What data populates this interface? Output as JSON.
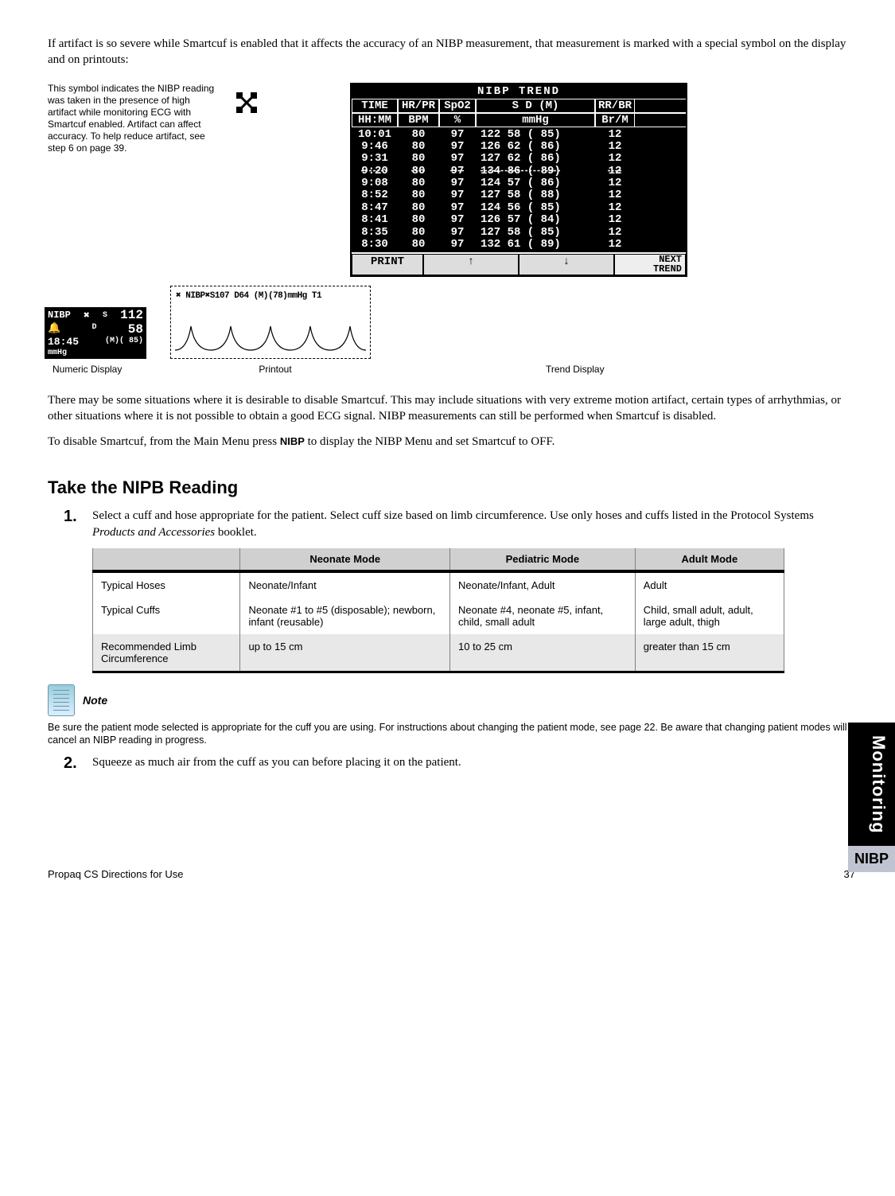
{
  "intro": "If artifact is so severe while Smartcuf is enabled that it affects the accuracy of an NIBP measurement, that measurement is marked with a special symbol on the display and on printouts:",
  "artifact_note": "This symbol indicates the NIBP reading was taken in the presence of high artifact while monitoring ECG with Smartcuf enabled. Artifact can affect accuracy. To help reduce artifact, see step 6 on page 39.",
  "trend": {
    "title": "NIBP TREND",
    "headers": [
      "TIME",
      "HR/PR",
      "SpO2",
      "S  D  (M)",
      "RR/BR"
    ],
    "units": [
      "HH:MM",
      "BPM",
      "%",
      "mmHg",
      "Br/M"
    ],
    "rows": [
      {
        "t": "10:01",
        "hr": "80",
        "sp": "97",
        "sdm": "122 58 ( 85)",
        "rr": "12"
      },
      {
        "t": " 9:46",
        "hr": "80",
        "sp": "97",
        "sdm": "126 62 ( 86)",
        "rr": "12"
      },
      {
        "t": " 9:31",
        "hr": "80",
        "sp": "97",
        "sdm": "127 62 ( 86)",
        "rr": "12"
      },
      {
        "t": " 9:20",
        "hr": "80",
        "sp": "97",
        "sdm": "134 86 ( 89)",
        "rr": "12",
        "strike": true
      },
      {
        "t": " 9:08",
        "hr": "80",
        "sp": "97",
        "sdm": "124 57 ( 86)",
        "rr": "12"
      },
      {
        "t": " 8:52",
        "hr": "80",
        "sp": "97",
        "sdm": "127 58 ( 88)",
        "rr": "12"
      },
      {
        "t": " 8:47",
        "hr": "80",
        "sp": "97",
        "sdm": "124 56 ( 85)",
        "rr": "12"
      },
      {
        "t": " 8:41",
        "hr": "80",
        "sp": "97",
        "sdm": "126 57 ( 84)",
        "rr": "12"
      },
      {
        "t": " 8:35",
        "hr": "80",
        "sp": "97",
        "sdm": "127 58 ( 85)",
        "rr": "12"
      },
      {
        "t": " 8:30",
        "hr": "80",
        "sp": "97",
        "sdm": "132 61 ( 89)",
        "rr": "12"
      }
    ],
    "footer": {
      "print": "PRINT",
      "up": "↑",
      "down": "↓",
      "next": "NEXT\nTREND"
    }
  },
  "numeric": {
    "label": "NIBP",
    "s_lbl": "S",
    "s": "112",
    "d_lbl": "D",
    "d": "58",
    "time": "18:45",
    "m": "(M)( 85)",
    "unit": "mmHg"
  },
  "printout_text": "✖ NIBP✖S107 D64 (M)(78)mmHg T1",
  "captions": {
    "num": "Numeric Display",
    "pr": "Printout",
    "tr": "Trend Display"
  },
  "para1": "There may be some situations where it is desirable to disable Smartcuf. This may include situations with very extreme motion artifact, certain types of arrhythmias, or other situations where it is not possible to obtain a good ECG signal. NIBP measurements can still be performed when Smartcuf is disabled.",
  "para2a": "To disable Smartcuf, from the Main Menu press ",
  "para2_key": "NIBP",
  "para2b": " to display the NIBP Menu and set Smartcuf to OFF.",
  "section_title": "Take the NIPB Reading",
  "step1_num": "1.",
  "step1_a": "Select a cuff and hose appropriate for the patient. Select cuff size based on limb circumference. Use only hoses and cuffs listed in the Protocol Systems ",
  "step1_i": "Products and Accessories",
  "step1_b": " booklet.",
  "table": {
    "cols": [
      "",
      "Neonate Mode",
      "Pediatric Mode",
      "Adult Mode"
    ],
    "rows": [
      [
        "Typical Hoses",
        "Neonate/Infant",
        "Neonate/Infant, Adult",
        "Adult"
      ],
      [
        "Typical Cuffs",
        "Neonate #1 to #5 (disposable); newborn, infant (reusable)",
        "Neonate #4, neonate #5, infant, child, small adult",
        "Child, small adult, adult, large adult, thigh"
      ],
      [
        "Recommended Limb Circumference",
        "up to 15 cm",
        "10 to 25 cm",
        "greater than 15 cm"
      ]
    ]
  },
  "note_label": "Note",
  "note_text": "Be sure the patient mode selected is appropriate for the cuff you are using. For instructions about changing the patient mode, see page 22. Be aware that changing patient modes will cancel an NIBP reading in progress.",
  "step2_num": "2.",
  "step2": "Squeeze as much air from the cuff as you can before placing it on the patient.",
  "footer_left": "Propaq CS Directions for Use",
  "footer_right": "37",
  "tab_main": "Monitoring",
  "tab_sub": "NIBP"
}
